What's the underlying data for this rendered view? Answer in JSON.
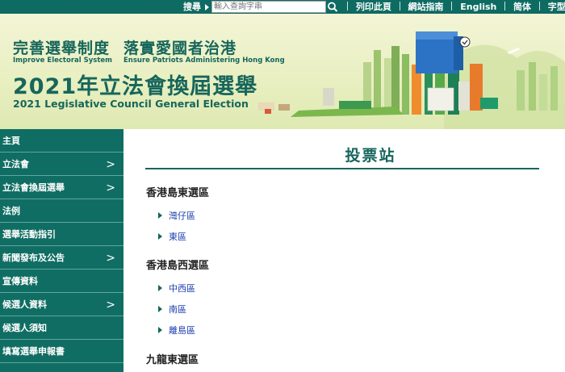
{
  "topbar": {
    "search_label": "搜尋",
    "search_placeholder": "輸入查詢字串",
    "links": [
      "列印此頁",
      "網站指南",
      "English",
      "简体",
      "字型大小"
    ]
  },
  "banner": {
    "line1_a": "完善選舉制度",
    "line1_b": "落實愛國者治港",
    "line1_en_a": "Improve Electoral System",
    "line1_en_b": "Ensure Patriots Administering Hong Kong",
    "line2": "2021年立法會換屆選舉",
    "line2_en": "2021 Legislative Council General Election"
  },
  "sidebar": {
    "items": [
      {
        "label": "主頁",
        "arrow": ""
      },
      {
        "label": "立法會",
        "arrow": ">"
      },
      {
        "label": "立法會換屆選舉",
        "arrow": ">"
      },
      {
        "label": "法例",
        "arrow": ""
      },
      {
        "label": "選舉活動指引",
        "arrow": ""
      },
      {
        "label": "新聞發布及公告",
        "arrow": ">"
      },
      {
        "label": "宣傳資料",
        "arrow": ""
      },
      {
        "label": "候選人資料",
        "arrow": ">"
      },
      {
        "label": "候選人須知",
        "arrow": ""
      },
      {
        "label": "填寫選舉申報書",
        "arrow": ""
      }
    ]
  },
  "main": {
    "title": "投票站",
    "regions": [
      {
        "name": "香港島東選區",
        "districts": [
          "灣仔區",
          "東區"
        ]
      },
      {
        "name": "香港島西選區",
        "districts": [
          "中西區",
          "南區",
          "離島區"
        ]
      },
      {
        "name": "九龍東選區",
        "districts": []
      }
    ]
  },
  "colors": {
    "brand": "#106d63",
    "link": "#1c3fae"
  }
}
